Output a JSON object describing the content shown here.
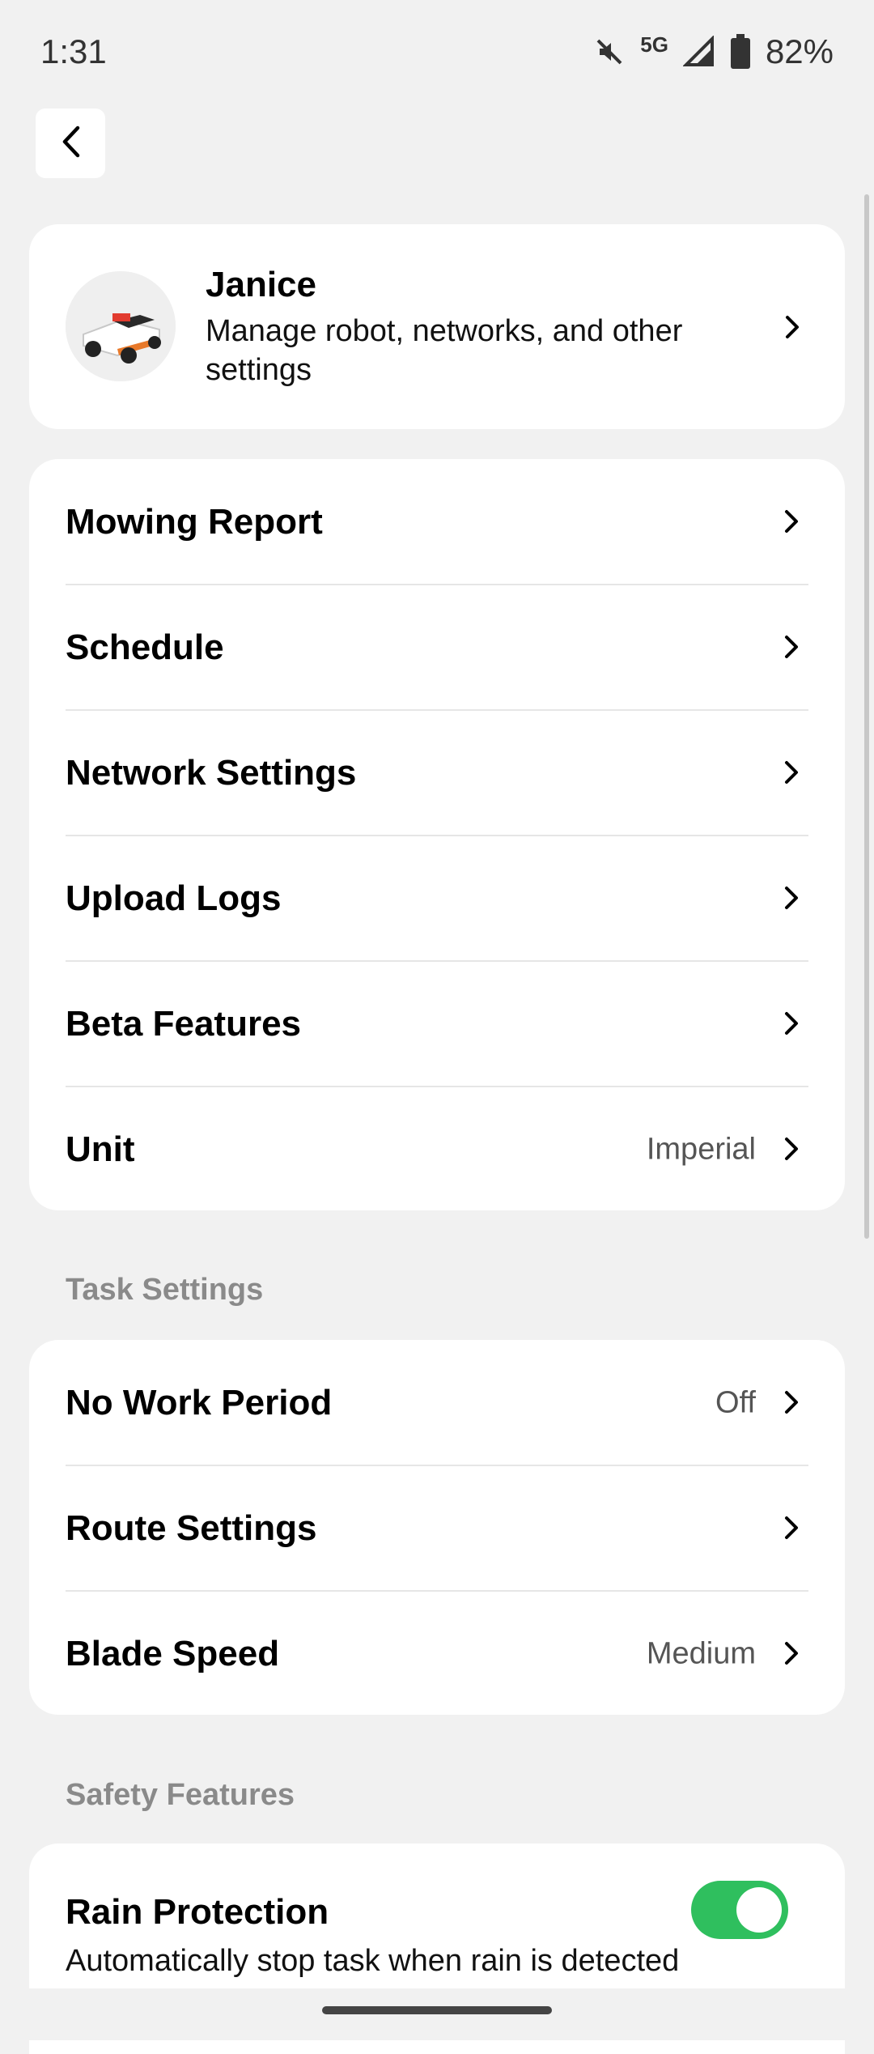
{
  "status_bar": {
    "time": "1:31",
    "network": "5G",
    "battery": "82%",
    "icons": [
      "mute-icon",
      "signal-icon",
      "battery-icon"
    ]
  },
  "header": {
    "back_icon": "chevron-left-icon"
  },
  "profile": {
    "name": "Janice",
    "description": "Manage robot, networks, and other settings"
  },
  "menu": {
    "items": [
      {
        "label": "Mowing Report",
        "value": ""
      },
      {
        "label": "Schedule",
        "value": ""
      },
      {
        "label": "Network Settings",
        "value": ""
      },
      {
        "label": "Upload Logs",
        "value": ""
      },
      {
        "label": "Beta Features",
        "value": ""
      },
      {
        "label": "Unit",
        "value": "Imperial"
      }
    ]
  },
  "task_settings": {
    "title": "Task Settings",
    "items": [
      {
        "label": "No Work Period",
        "value": "Off"
      },
      {
        "label": "Route Settings",
        "value": ""
      },
      {
        "label": "Blade Speed",
        "value": "Medium"
      }
    ]
  },
  "safety": {
    "title": "Safety Features",
    "rain_protection": {
      "label": "Rain Protection",
      "description": "Automatically stop task when rain is detected",
      "enabled": true
    }
  },
  "colors": {
    "accent": "#2fbf5e",
    "background": "#f1f1f1",
    "card": "#ffffff"
  }
}
